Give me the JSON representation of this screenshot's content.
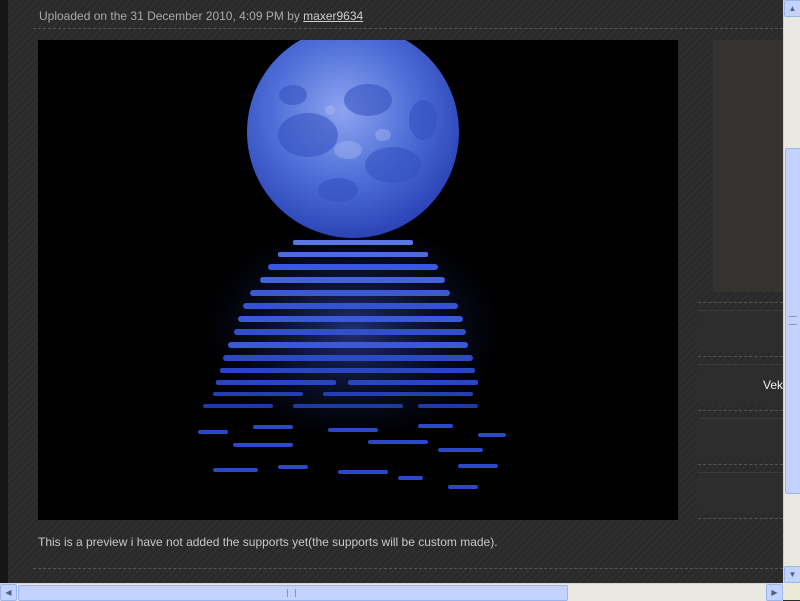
{
  "upload": {
    "prefix": "Uploaded on the 31 December 2010, 4:09 PM by ",
    "author": "maxer9634"
  },
  "image": {
    "subject": "blue full moon reflected in dark water",
    "colors": {
      "moon": "#3d5fd0",
      "water": "#2c47c8",
      "background": "#000000"
    }
  },
  "caption": "This is a preview i have not added the supports yet(the supports will be custom made).",
  "sidebar": {
    "boxes": [
      {
        "text": ""
      },
      {
        "text": "Vek"
      },
      {
        "text": ""
      },
      {
        "text": ""
      }
    ]
  },
  "scrollbars": {
    "up_icon": "arrow-up-icon",
    "down_icon": "arrow-down-icon",
    "left_icon": "arrow-left-icon",
    "right_icon": "arrow-right-icon"
  },
  "theme": {
    "page_bg": "#2a2a2a",
    "scroll_accent": "#c3d3fd"
  }
}
